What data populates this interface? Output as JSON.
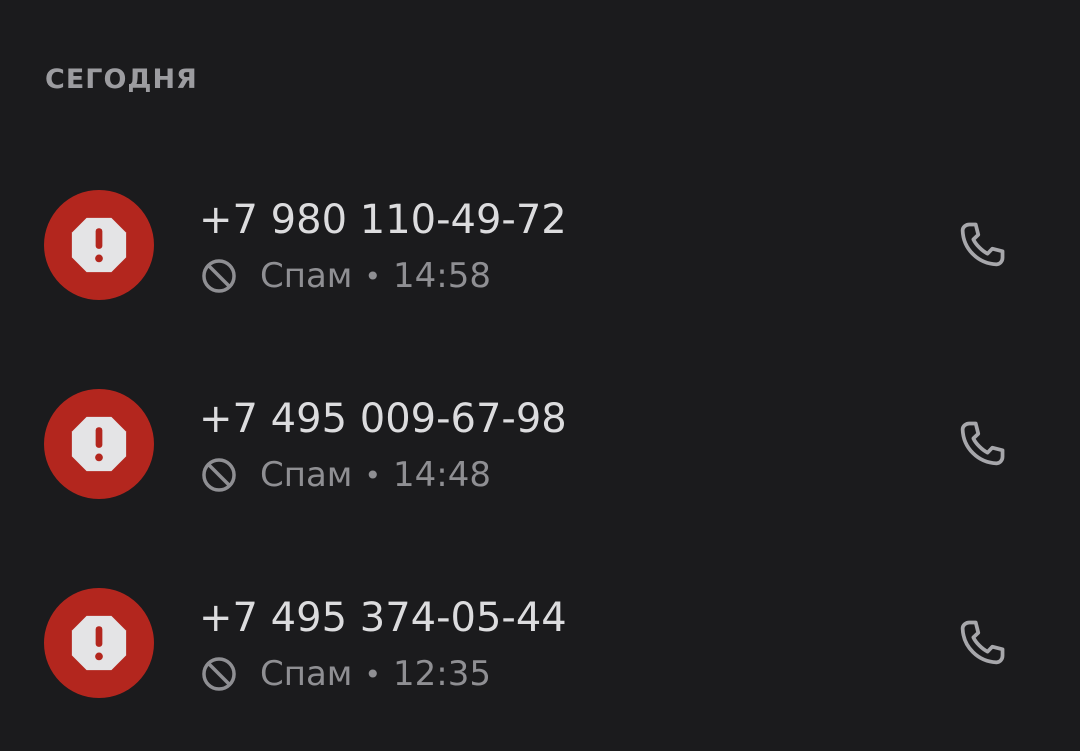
{
  "section": {
    "title": "СЕГОДНЯ"
  },
  "colors": {
    "avatar_bg": "#b3261e",
    "avatar_symbol": "#e4e4e6",
    "avatar_mark": "#b3261e"
  },
  "calls": [
    {
      "number": "+7 980 110-49-72",
      "status_icon": "block-icon",
      "status": "Спам",
      "separator": "•",
      "time": "14:58",
      "avatar_icon": "spam-warning-icon",
      "action_icon": "phone-icon"
    },
    {
      "number": "+7 495 009-67-98",
      "status_icon": "block-icon",
      "status": "Спам",
      "separator": "•",
      "time": "14:48",
      "avatar_icon": "spam-warning-icon",
      "action_icon": "phone-icon"
    },
    {
      "number": "+7 495 374-05-44",
      "status_icon": "block-icon",
      "status": "Спам",
      "separator": "•",
      "time": "12:35",
      "avatar_icon": "spam-warning-icon",
      "action_icon": "phone-icon"
    }
  ]
}
